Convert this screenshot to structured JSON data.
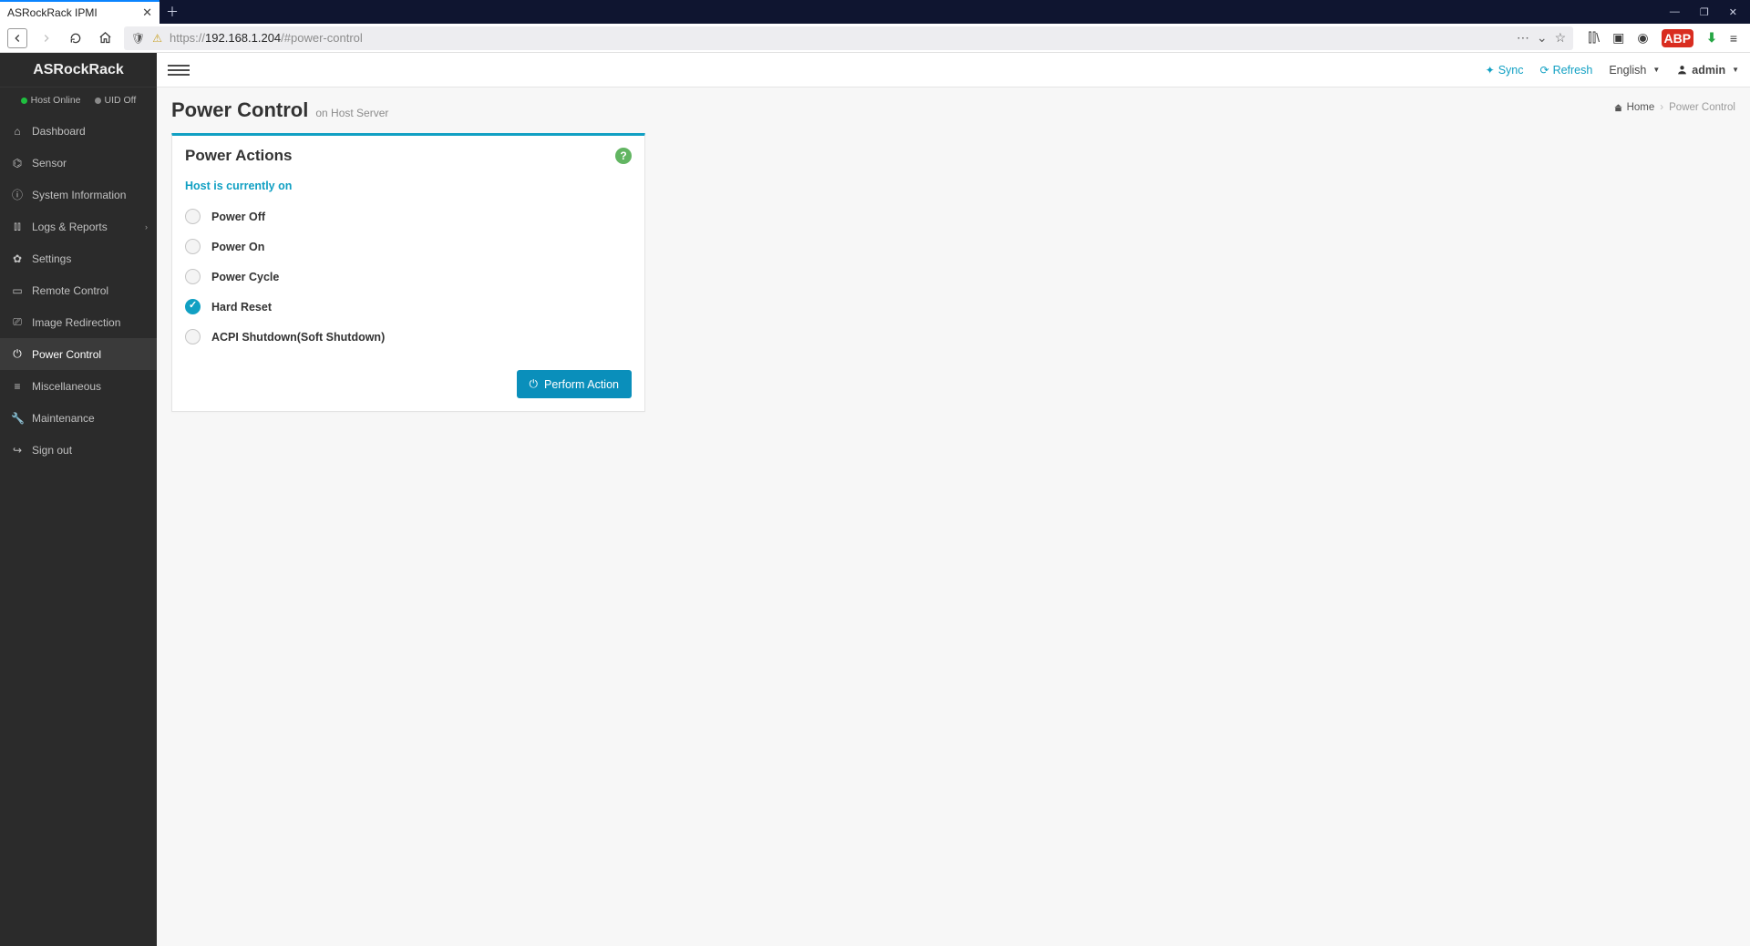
{
  "browser": {
    "tab_title": "ASRockRack IPMI",
    "url_proto": "https://",
    "url_host": "192.168.1.204",
    "url_path": "/#power-control"
  },
  "sidebar": {
    "brand": "ASRockRack",
    "host_status": "Host Online",
    "uid_status": "UID Off",
    "items": [
      {
        "icon": "home-icon",
        "glyph": "⌂",
        "label": "Dashboard"
      },
      {
        "icon": "dashboard-icon",
        "glyph": "⌬",
        "label": "Sensor"
      },
      {
        "icon": "info-icon",
        "glyph": "ⓘ",
        "label": "System Information"
      },
      {
        "icon": "bars-icon",
        "glyph": "⫾⫾",
        "label": "Logs & Reports",
        "caret": true
      },
      {
        "icon": "gear-icon",
        "glyph": "✿",
        "label": "Settings"
      },
      {
        "icon": "monitor-icon",
        "glyph": "▭",
        "label": "Remote Control"
      },
      {
        "icon": "image-icon",
        "glyph": "⎚",
        "label": "Image Redirection"
      },
      {
        "icon": "power-icon",
        "glyph": "⏻",
        "label": "Power Control",
        "active": true
      },
      {
        "icon": "list-icon",
        "glyph": "≡",
        "label": "Miscellaneous"
      },
      {
        "icon": "wrench-icon",
        "glyph": "🔧",
        "label": "Maintenance"
      },
      {
        "icon": "signout-icon",
        "glyph": "↪",
        "label": "Sign out"
      }
    ]
  },
  "topbar": {
    "sync": "Sync",
    "refresh": "Refresh",
    "language": "English",
    "user": "admin"
  },
  "page": {
    "title": "Power Control",
    "subtitle": "on Host Server"
  },
  "breadcrumb": {
    "home": "Home",
    "current": "Power Control"
  },
  "card": {
    "title": "Power Actions",
    "status": "Host is currently on",
    "options": [
      {
        "label": "Power Off",
        "selected": false
      },
      {
        "label": "Power On",
        "selected": false
      },
      {
        "label": "Power Cycle",
        "selected": false
      },
      {
        "label": "Hard Reset",
        "selected": true
      },
      {
        "label": "ACPI Shutdown(Soft Shutdown)",
        "selected": false
      }
    ],
    "button": "Perform Action"
  }
}
